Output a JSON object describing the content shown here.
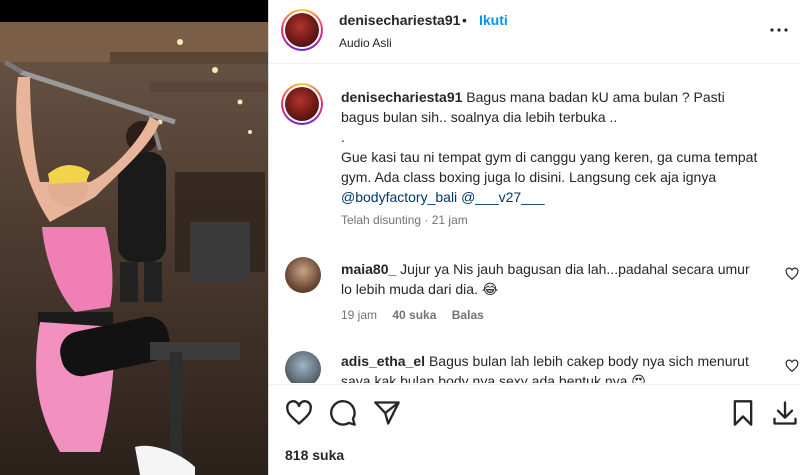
{
  "post": {
    "username": "denisechariesta91",
    "separator": "•",
    "follow_label": "Ikuti",
    "audio_label": "Audio Asli",
    "more_icon": "more-horizontal-icon"
  },
  "caption": {
    "username": "denisechariesta91",
    "line1": "Bagus mana badan kU ama bulan ? Pasti bagus bulan sih.. soalnya dia lebih terbuka ..",
    "line2": ".",
    "line3": "Gue kasi tau ni tempat gym di canggu yang keren, ga cuma tempat gym. Ada class boxing juga lo disini. Langsung cek aja ignya ",
    "mention1": "@bodyfactory_bali",
    "mention2": "@___v27___",
    "edited": "Telah disunting",
    "dot": "·",
    "time": "21 jam"
  },
  "comments": [
    {
      "username": "maia80_",
      "text": "Jujur ya Nis jauh bagusan dia lah...padahal secara umur lo lebih muda dari dia. 😂",
      "time": "19 jam",
      "likes": "40 suka",
      "reply": "Balas"
    },
    {
      "username": "adis_etha_el",
      "text": "Bagus bulan lah lebih cakep body nya sich menurut saya kak bulan body nya sexy ada bentuk nya 😍"
    }
  ],
  "actions": {
    "like_icon": "heart-icon",
    "comment_icon": "comment-icon",
    "share_icon": "paper-plane-icon",
    "save_icon": "bookmark-icon",
    "download_icon": "download-icon"
  },
  "likes_count": "818 suka",
  "colors": {
    "link_blue": "#0095f6",
    "mention_blue": "#00376b",
    "secondary_text": "#737373",
    "primary_text": "#262626"
  }
}
